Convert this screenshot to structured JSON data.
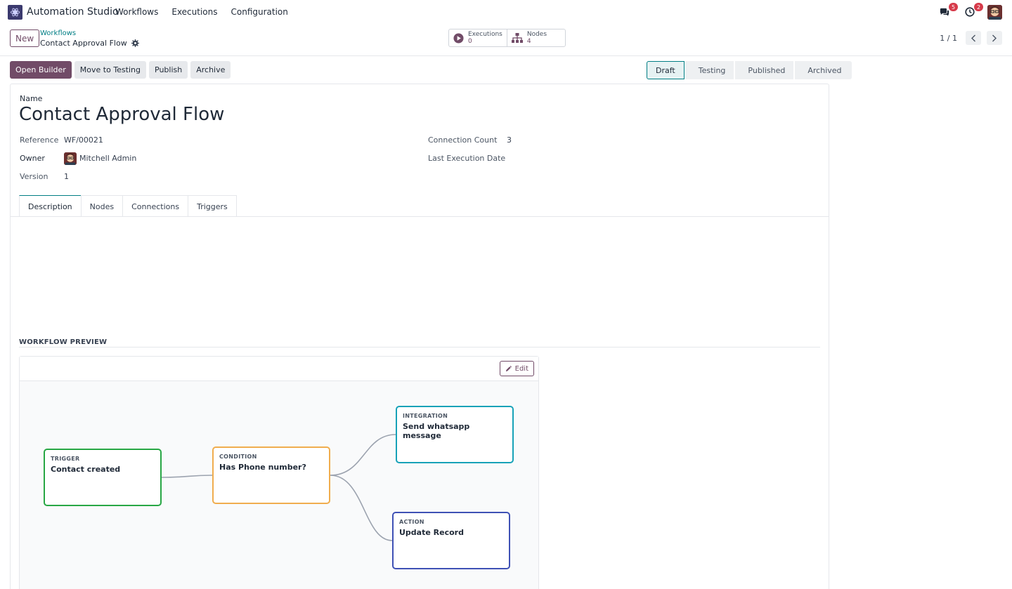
{
  "navbar": {
    "app_title": "Automation Studio",
    "menu": [
      "Workflows",
      "Executions",
      "Configuration"
    ],
    "messages_badge": "5",
    "activities_badge": "2"
  },
  "control_panel": {
    "new_label": "New",
    "breadcrumb": "Workflows",
    "record_title": "Contact Approval Flow",
    "smart_buttons": [
      {
        "label": "Executions",
        "value": "0"
      },
      {
        "label": "Nodes",
        "value": "4"
      }
    ],
    "pager": "1 / 1"
  },
  "actions": {
    "open_builder": "Open Builder",
    "move_to_testing": "Move to Testing",
    "publish": "Publish",
    "archive": "Archive"
  },
  "statusbar": {
    "steps": [
      "Draft",
      "Testing",
      "Published",
      "Archived"
    ],
    "active": "Draft"
  },
  "form": {
    "name_label": "Name",
    "name_value": "Contact Approval Flow",
    "reference_label": "Reference",
    "reference_value": "WF/00021",
    "owner_label": "Owner",
    "owner_value": "Mitchell Admin",
    "version_label": "Version",
    "version_value": "1",
    "connection_count_label": "Connection Count",
    "connection_count_value": "3",
    "last_execution_label": "Last Execution Date",
    "last_execution_value": ""
  },
  "tabs": [
    "Description",
    "Nodes",
    "Connections",
    "Triggers"
  ],
  "preview": {
    "section_title": "WORKFLOW PREVIEW",
    "edit_label": "Edit",
    "nodes": [
      {
        "type": "TRIGGER",
        "title": "Contact created",
        "color": "#28a745"
      },
      {
        "type": "CONDITION",
        "title": "Has Phone number?",
        "color": "#f0ad4e"
      },
      {
        "type": "INTEGRATION",
        "title": "Send whatsapp message",
        "color": "#17a2b8"
      },
      {
        "type": "ACTION",
        "title": "Update Record",
        "color": "#3f51b5"
      }
    ]
  },
  "colors": {
    "primary": "#714b67",
    "link": "#017e84"
  }
}
